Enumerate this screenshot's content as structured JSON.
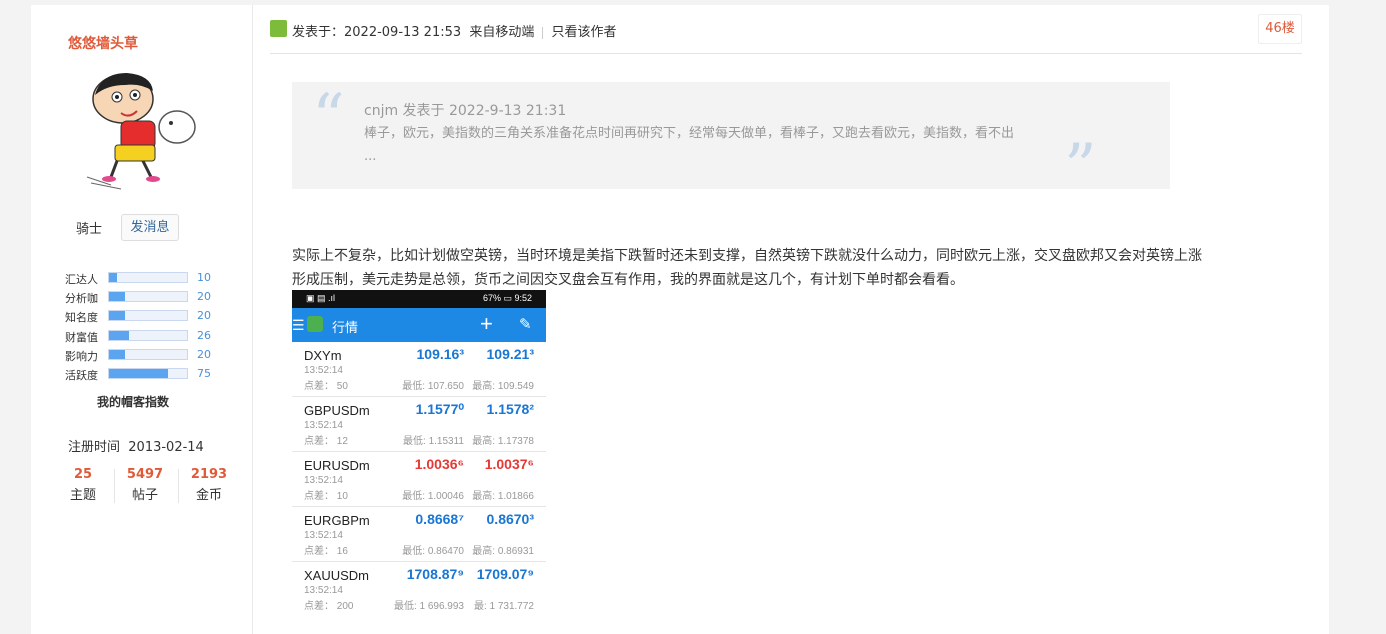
{
  "profile": {
    "username": "悠悠墙头草",
    "rank": "骑士",
    "message_button": "发消息",
    "stats": [
      {
        "label": "汇达人",
        "value": "10",
        "fill": 0.1
      },
      {
        "label": "分析咖",
        "value": "20",
        "fill": 0.2
      },
      {
        "label": "知名度",
        "value": "20",
        "fill": 0.2
      },
      {
        "label": "财富值",
        "value": "26",
        "fill": 0.26
      },
      {
        "label": "影响力",
        "value": "20",
        "fill": 0.2
      },
      {
        "label": "活跃度",
        "value": "75",
        "fill": 0.75
      }
    ],
    "index_title": "我的帽客指数",
    "register_label": "注册时间",
    "register_date": "2013-02-14",
    "counts": [
      {
        "num": "25",
        "label": "主题"
      },
      {
        "num": "5497",
        "label": "帖子"
      },
      {
        "num": "2193",
        "label": "金币"
      }
    ]
  },
  "post": {
    "posted_label": "发表于：2022-09-13 21:53",
    "source": "来自移动端",
    "only_author": "只看该作者",
    "floor": "46楼",
    "quote": {
      "author": "cnjm 发表于 2022-9-13 21:31",
      "text": "棒子，欧元，美指数的三角关系准备花点时间再研究下，经常每天做单，看棒子，又跑去看欧元，美指数，看不出 ..."
    },
    "body": "实际上不复杂，比如计划做空英镑，当时环境是美指下跌暂时还未到支撑，自然英镑下跌就没什么动力，同时欧元上涨，交叉盘欧邦又会对英镑上涨形成压制，美元走势是总领，货币之间因交叉盘会互有作用，我的界面就是这几个，有计划下单时都会看看。"
  },
  "phone": {
    "status_left": "▣ ▤ .ıl",
    "status_right": "67% ▭ 9:52",
    "title": "行情",
    "quotes": [
      {
        "symbol": "DXYm",
        "time": "13:52:14",
        "spread": "点差： 50",
        "bid": "109.16³",
        "ask": "109.21³",
        "low": "最低: 107.650",
        "high": "最高: 109.549",
        "color": "blue"
      },
      {
        "symbol": "GBPUSDm",
        "time": "13:52:14",
        "spread": "点差： 12",
        "bid": "1.1577⁰",
        "ask": "1.1578²",
        "low": "最低: 1.15311",
        "high": "最高: 1.17378",
        "color": "blue"
      },
      {
        "symbol": "EURUSDm",
        "time": "13:52:14",
        "spread": "点差： 10",
        "bid": "1.0036⁶",
        "ask": "1.0037⁶",
        "low": "最低: 1.00046",
        "high": "最高: 1.01866",
        "color": "red"
      },
      {
        "symbol": "EURGBPm",
        "time": "13:52:14",
        "spread": "点差： 16",
        "bid": "0.8668⁷",
        "ask": "0.8670³",
        "low": "最低: 0.86470",
        "high": "最高: 0.86931",
        "color": "blue"
      },
      {
        "symbol": "XAUUSDm",
        "time": "13:52:14",
        "spread": "点差： 200",
        "bid": "1708.87⁹",
        "ask": "1709.07⁹",
        "low": "最低: 1 696.993",
        "high": "最: 1 731.772",
        "color": "blue"
      }
    ]
  }
}
